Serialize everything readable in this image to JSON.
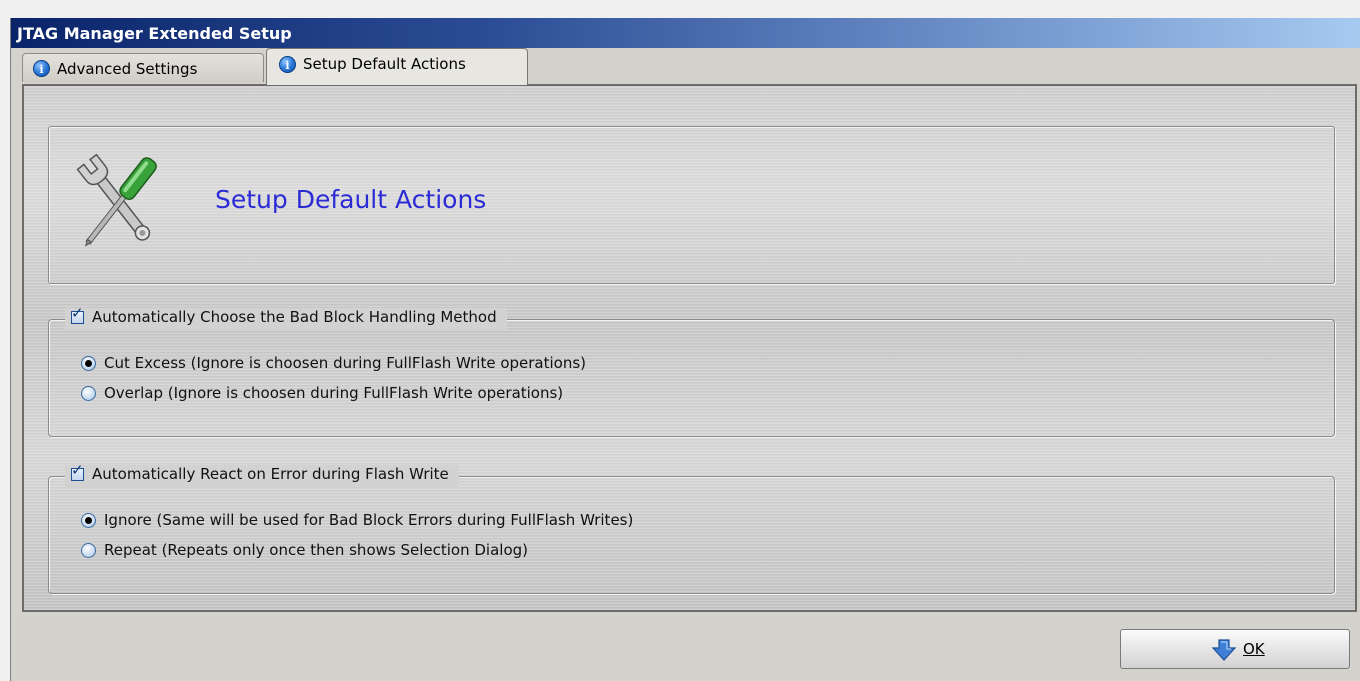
{
  "window": {
    "title": "JTAG Manager Extended Setup"
  },
  "tabs": [
    {
      "label": "Advanced Settings",
      "icon": "info-icon",
      "active": false
    },
    {
      "label": "Setup Default Actions",
      "icon": "info-icon",
      "active": true
    }
  ],
  "header": {
    "icon": "tools-icon",
    "title": "Setup Default Actions"
  },
  "groups": [
    {
      "label": "Automatically Choose the Bad Block Handling Method",
      "checked": true,
      "options": [
        {
          "label": "Cut Excess (Ignore is choosen during FullFlash Write operations)",
          "selected": true
        },
        {
          "label": "Overlap (Ignore is choosen during FullFlash Write operations)",
          "selected": false
        }
      ]
    },
    {
      "label": "Automatically React on Error during Flash Write",
      "checked": true,
      "options": [
        {
          "label": "Ignore (Same will be used for Bad Block Errors during FullFlash Writes)",
          "selected": true
        },
        {
          "label": "Repeat (Repeats only once then shows Selection Dialog)",
          "selected": false
        }
      ]
    }
  ],
  "ok_button": {
    "label": "OK",
    "icon": "arrow-down-icon"
  },
  "colors": {
    "title_bar_start": "#0a246a",
    "title_bar_end": "#a6caf0",
    "header_title": "#2b2bd6"
  }
}
